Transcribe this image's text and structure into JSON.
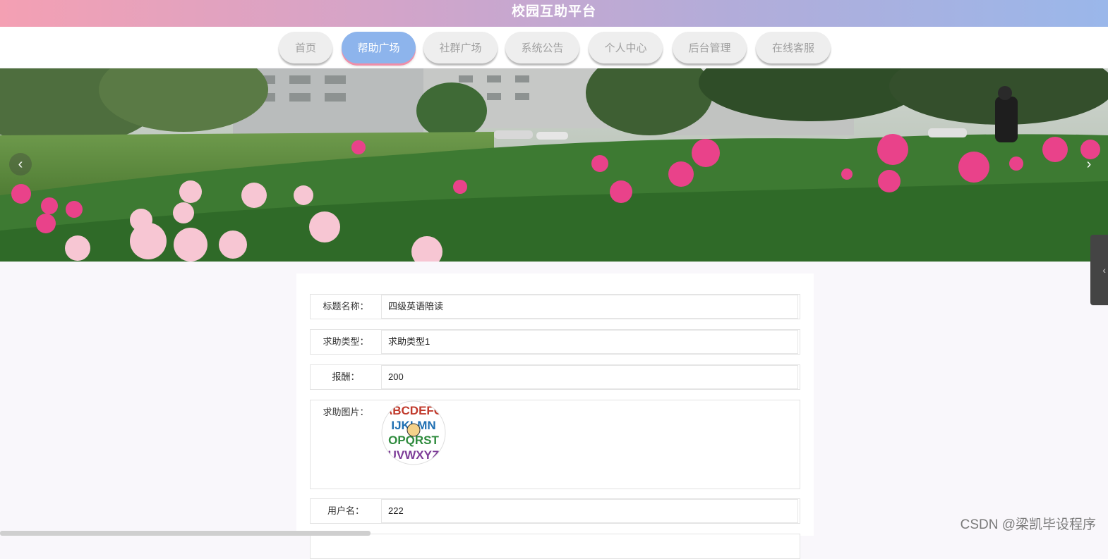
{
  "app": {
    "title": "校园互助平台"
  },
  "nav": {
    "items": [
      {
        "label": "首页"
      },
      {
        "label": "帮助广场"
      },
      {
        "label": "社群广场"
      },
      {
        "label": "系统公告"
      },
      {
        "label": "个人中心"
      },
      {
        "label": "后台管理"
      },
      {
        "label": "在线客服"
      }
    ],
    "active_index": 1
  },
  "banner": {
    "prev_icon": "chevron-left-icon",
    "next_icon": "chevron-right-icon"
  },
  "detail": {
    "fields": [
      {
        "label": "标题名称：",
        "value": "四级英语陪读"
      },
      {
        "label": "求助类型：",
        "value": "求助类型1"
      },
      {
        "label": "报酬：",
        "value": "200"
      },
      {
        "label": "求助图片：",
        "value": ""
      },
      {
        "label": "用户名：",
        "value": "222"
      }
    ],
    "image_alphabet": [
      "ABCDEFG",
      "IJKLMN",
      "OPQRST",
      "UVWXYZ"
    ]
  },
  "watermark": "CSDN @梁凯毕设程序",
  "colors": {
    "header_gradient_start": "#f4a0b3",
    "header_gradient_end": "#9ab7ea",
    "nav_active": "#8db4ec",
    "nav_active_underline": "#f08ea8"
  }
}
